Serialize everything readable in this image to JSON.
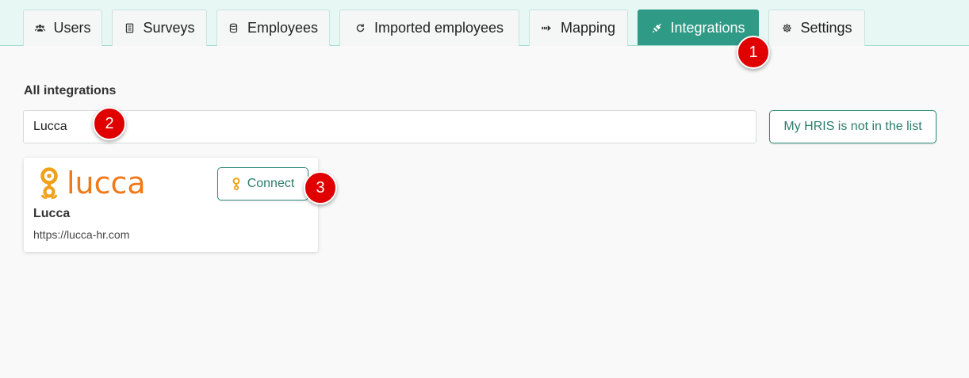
{
  "tabs": [
    {
      "label": "Users",
      "icon": "users-icon"
    },
    {
      "label": "Surveys",
      "icon": "survey-icon"
    },
    {
      "label": "Employees",
      "icon": "database-icon"
    },
    {
      "label": "Imported employees",
      "icon": "refresh-icon"
    },
    {
      "label": "Mapping",
      "icon": "arrows-right-icon"
    },
    {
      "label": "Integrations",
      "icon": "plug-icon",
      "active": true
    },
    {
      "label": "Settings",
      "icon": "gear-icon"
    }
  ],
  "section_title": "All integrations",
  "search": {
    "value": "Lucca"
  },
  "hris_button_label": "My HRIS is not in the list",
  "integration_card": {
    "logo_text": "lucca",
    "name": "Lucca",
    "url": "https://lucca-hr.com",
    "connect_label": "Connect"
  },
  "markers": [
    "1",
    "2",
    "3"
  ],
  "colors": {
    "accent": "#2f9a85",
    "tab_bar_bg": "#e6f7f4",
    "brand_orange": "#f07a1a",
    "marker_red": "#e00000"
  }
}
